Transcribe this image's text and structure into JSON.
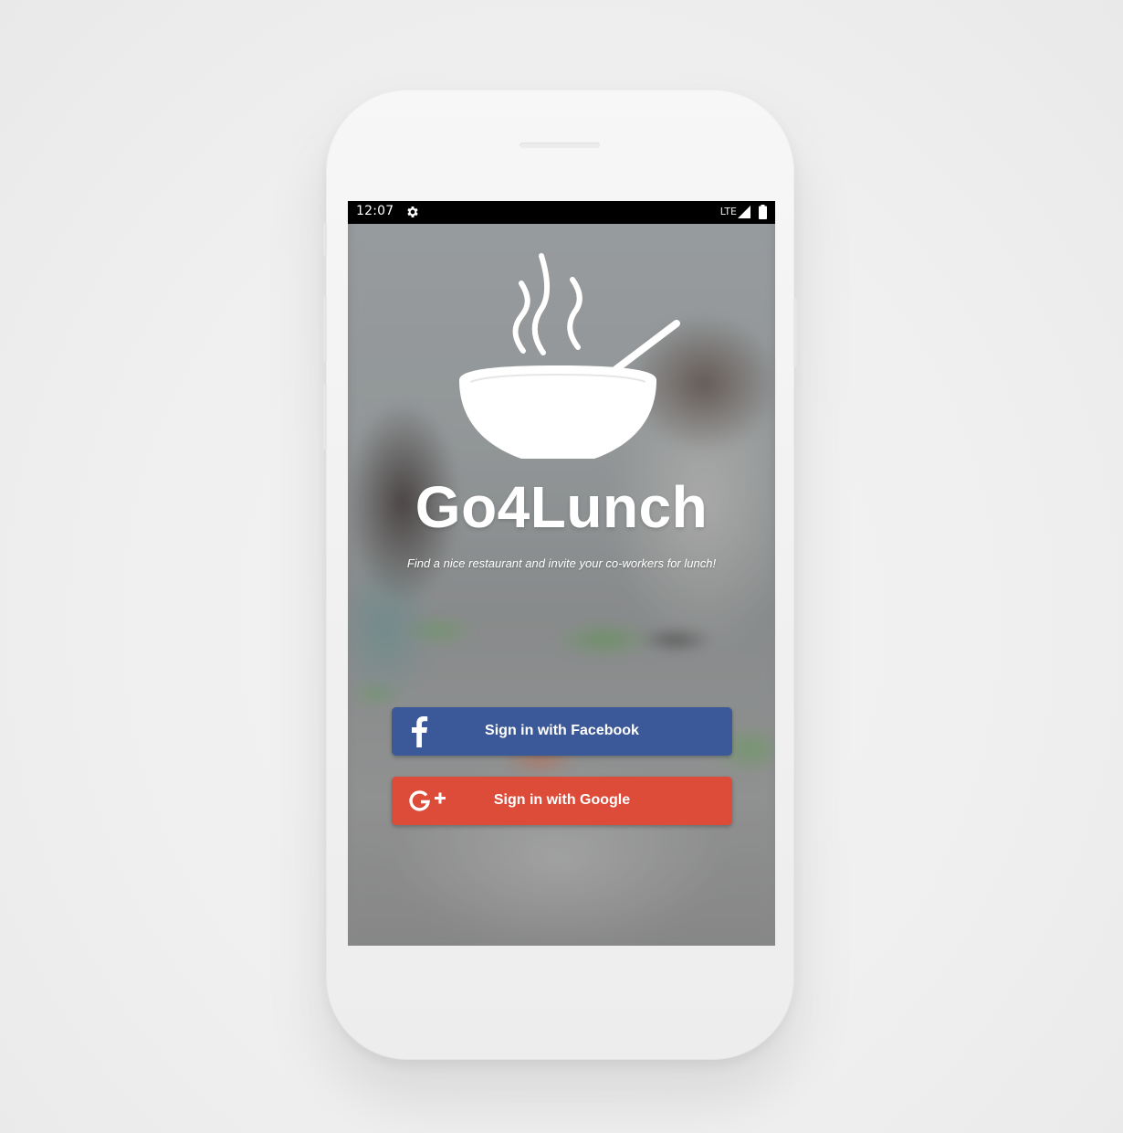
{
  "status_bar": {
    "time": "12:07",
    "network": "LTE",
    "icons": [
      "settings-gear-icon",
      "signal-icon",
      "battery-icon"
    ]
  },
  "app": {
    "name": "Go4Lunch",
    "tagline": "Find a nice restaurant and invite your co-workers for lunch!",
    "logo_icon": "steaming-bowl-icon"
  },
  "auth": {
    "facebook": {
      "label": "Sign in with Facebook",
      "icon": "facebook-icon",
      "color": "#3b5998"
    },
    "google": {
      "label": "Sign in with Google",
      "icon": "google-plus-icon",
      "color": "#dd4b39"
    }
  },
  "colors": {
    "status_bar_bg": "#000000",
    "text": "#ffffff"
  }
}
